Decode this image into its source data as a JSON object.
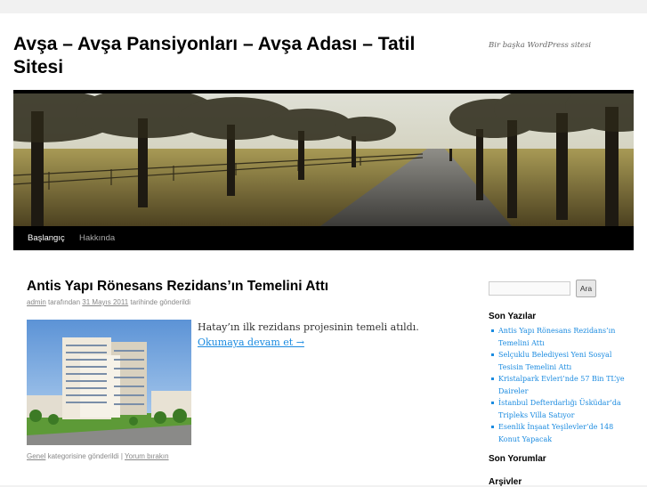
{
  "site": {
    "title": "Avşa – Avşa Pansiyonları – Avşa Adası – Tatil Sitesi",
    "description": "Bir başka WordPress sitesi"
  },
  "nav": {
    "items": [
      {
        "label": "Başlangıç",
        "current": true
      },
      {
        "label": "Hakkında",
        "current": false
      }
    ]
  },
  "post": {
    "title": "Antis Yapı Rönesans Rezidans’ın Temelini Attı",
    "meta": {
      "author": "admin",
      "by_label": "tarafından",
      "date": "31 Mayıs 2011",
      "date_suffix": "tarihinde gönderildi"
    },
    "excerpt": "Hatay’ın ilk rezidans projesinin temeli atıldı.",
    "more_link": "Okumaya devam et →",
    "footer": {
      "category": "Genel",
      "category_suffix": "kategorisine gönderildi",
      "separator": "|",
      "comment_link": "Yorum bırakın"
    }
  },
  "sidebar": {
    "search": {
      "placeholder": "",
      "button": "Ara"
    },
    "recent_title": "Son Yazılar",
    "recent_posts": [
      "Antis Yapı Rönesans Rezidans’ın Temelini Attı",
      "Selçuklu Belediyesi Yeni Sosyal Tesisin Temelini Attı",
      "Kristalpark Evleri’nde 57 Bin TL’ye Daireler",
      "İstanbul Defterdarlığı Üsküdar’da Tripleks Villa Satıyor",
      "Esenlik İnşaat Yeşilevler’de 148 Konut Yapacak"
    ],
    "comments_title": "Son Yorumlar",
    "archives_title": "Arşivler"
  },
  "colors": {
    "link": "#1b8be0",
    "nav_bar": "#000000",
    "page_bg": "#f1f1f1"
  }
}
